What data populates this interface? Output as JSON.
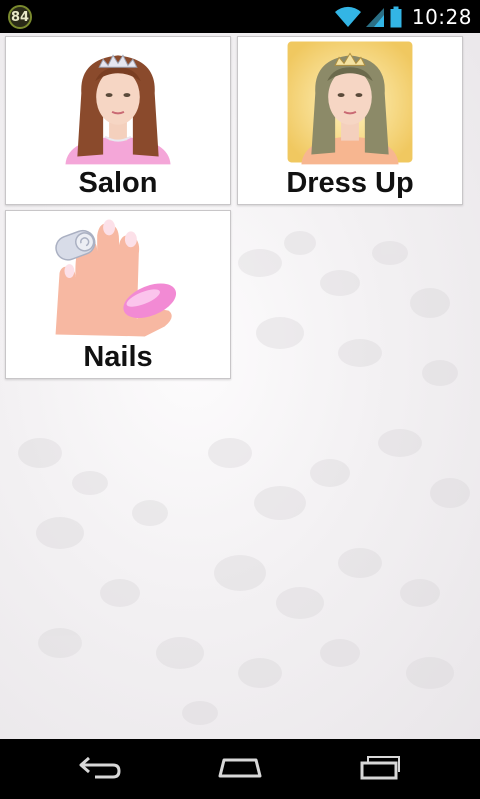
{
  "status_bar": {
    "notification_count": "84",
    "time": "10:28",
    "icons": [
      "wifi-icon",
      "signal-icon",
      "battery-icon"
    ]
  },
  "tiles": [
    {
      "label": "Salon",
      "icon": "salon-girl-icon"
    },
    {
      "label": "Dress Up",
      "icon": "dressup-girl-icon"
    },
    {
      "label": "Nails",
      "icon": "nails-hand-icon"
    }
  ],
  "nav_bar": {
    "icons": [
      "back-icon",
      "home-icon",
      "recent-apps-icon"
    ]
  },
  "colors": {
    "status_bar_bg": "#000000",
    "nav_bar_bg": "#000000",
    "tile_bg": "#ffffff",
    "label_text": "#111111",
    "status_accent": "#33b5e5"
  }
}
